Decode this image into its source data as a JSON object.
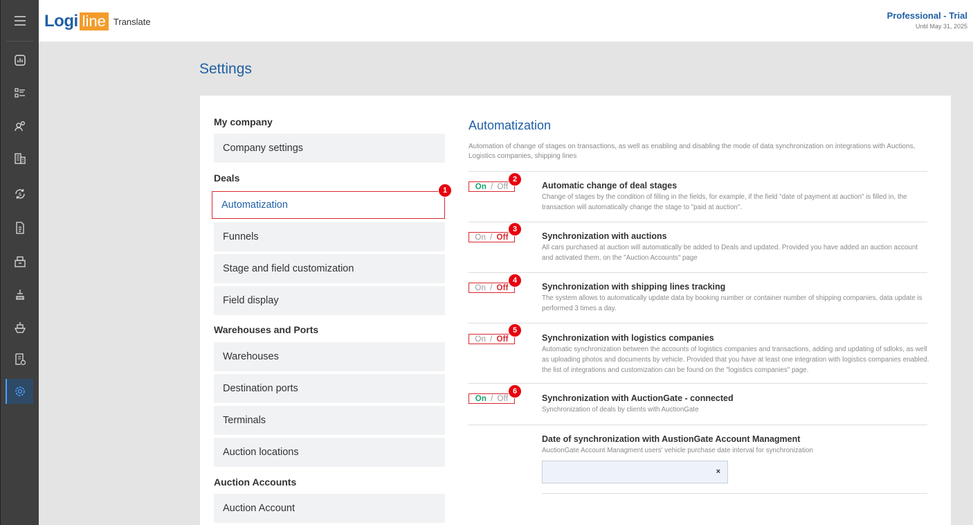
{
  "header": {
    "logo_left": "Logi",
    "logo_right": "line",
    "translate_label": "Translate",
    "plan_title": "Professional - Trial",
    "plan_until": "Until May 31, 2025"
  },
  "sidebar": {
    "icons": [
      "menu-icon",
      "dashboard-icon",
      "checklist-icon",
      "users-icon",
      "buildings-icon",
      "sync-dollar-icon",
      "document-icon",
      "box-icon",
      "crane-icon",
      "ship-icon",
      "invoice-icon",
      "settings-icon"
    ],
    "active": "settings-icon"
  },
  "page": {
    "title": "Settings"
  },
  "menu": {
    "groups": [
      {
        "label": "My company",
        "items": [
          "Company settings"
        ]
      },
      {
        "label": "Deals",
        "items": [
          "Automatization",
          "Funnels",
          "Stage and field customization",
          "Field display"
        ]
      },
      {
        "label": "Warehouses and Ports",
        "items": [
          "Warehouses",
          "Destination ports",
          "Terminals",
          "Auction locations"
        ]
      },
      {
        "label": "Auction Accounts",
        "items": [
          "Auction Account"
        ]
      }
    ],
    "active_item": "Automatization"
  },
  "section": {
    "title": "Automatization",
    "description": "Automation of change of stages on transactions, as well as enabling and disabling the mode of data synchronization on integrations with Auctions, Logistics companies, shipping lines"
  },
  "toggle_labels": {
    "on": "On",
    "sep": "/",
    "off": "Off"
  },
  "options": [
    {
      "state": "on",
      "badge": "2",
      "title": "Automatic change of deal stages",
      "description": "Change of stages by the condition of filling in the fields, for example, if the field \"date of payment at auction\" is filled in, the transaction will automatically change the stage to \"paid at auction\"."
    },
    {
      "state": "off",
      "badge": "3",
      "title": "Synchronization with auctions",
      "description": "All cars purchased at auction will automatically be added to Deals and updated. Provided you have added an auction account and activated them, on the \"Auction Accounts\" page"
    },
    {
      "state": "off",
      "badge": "4",
      "title": "Synchronization with shipping lines tracking",
      "description": "The system allows to automatically update data by booking number or container number of shipping companies, data update is performed 3 times a day."
    },
    {
      "state": "off",
      "badge": "5",
      "title": "Synchronization with logistics companies",
      "description": "Automatic synchronization between the accounts of logistics companies and transactions, adding and updating of sdloks, as well as uploading photos and documents by vehicle. Provided that you have at least one integration with logistics companies enabled. the list of integrations and customization can be found on the \"logistics companies\" page."
    },
    {
      "state": "on",
      "badge": "6",
      "title": "Synchronization with AuctionGate - connected",
      "description": "Synchronization of deals by clients with AuctionGate"
    }
  ],
  "date_sync": {
    "title": "Date of synchronization with AustionGate Account Managment",
    "description": "AuctionGate Account Managment users' vehicle purchase date interval for synchronization",
    "value": "",
    "clear_label": "×"
  },
  "badges": {
    "menu": "1"
  },
  "colors": {
    "brand": "#1f5fa6",
    "accent": "#f39c2b",
    "danger": "#d9282f",
    "on": "#14a26b"
  }
}
